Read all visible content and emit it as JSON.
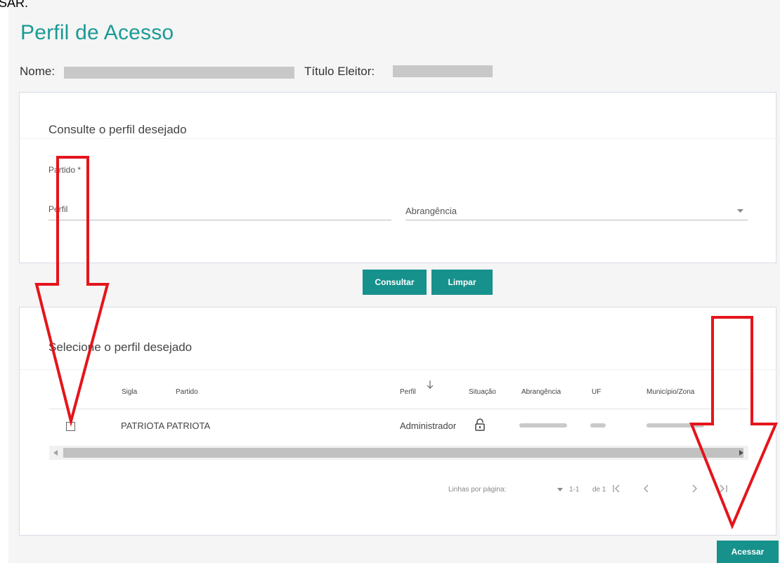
{
  "top_fragment": "SAR.",
  "page": {
    "title": "Perfil de Acesso",
    "nome_label": "Nome:",
    "titulo_label": "Título Eleitor:"
  },
  "search_card": {
    "title": "Consulte o perfil desejado",
    "partido_label": "Partido *",
    "perfil_label": "Perfil",
    "abrangencia_label": "Abrangência"
  },
  "buttons": {
    "consultar": "Consultar",
    "limpar": "Limpar",
    "acessar": "Acessar"
  },
  "results_card": {
    "title": "Selecione o perfil desejado",
    "columns": {
      "sigla": "Sigla",
      "partido": "Partido",
      "perfil": "Perfil",
      "situacao": "Situação",
      "abrangencia": "Abrangência",
      "uf": "UF",
      "municipio": "Município/Zona"
    },
    "rows": [
      {
        "sigla": "PATRIOTA",
        "partido": "PATRIOTA",
        "perfil": "Administrador"
      }
    ]
  },
  "pagination": {
    "rows_per_page_label": "Linhas por página:",
    "range": "1-1",
    "of": "de 1"
  },
  "colors": {
    "accent": "#1a9a95",
    "button": "#17918c",
    "annotation_arrow": "#e5141b"
  },
  "icons": {
    "sort": "arrow-down-icon",
    "situacao": "lock-open-icon",
    "dropdown": "caret-down-icon"
  }
}
